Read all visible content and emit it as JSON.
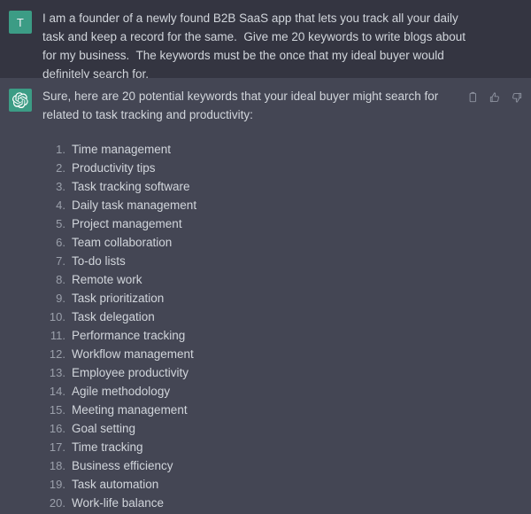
{
  "theme": {
    "user_bg": "#343541",
    "assistant_bg": "#444654",
    "text_color": "#d1d5db",
    "muted_color": "#9ba0ab",
    "avatar_bg": "#3c9c85"
  },
  "user_message": {
    "avatar_initial": "T",
    "text": "I am a founder of a newly found B2B SaaS app that lets you track all your daily task and keep a record for the same.  Give me 20 keywords to write blogs about for my business.  The keywords must be the once that my ideal buyer would definitely search for."
  },
  "assistant_message": {
    "avatar_icon": "openai-logo-icon",
    "intro": "Sure, here are 20 potential keywords that your ideal buyer might search for related to task tracking and productivity:",
    "actions": [
      {
        "name": "copy-button",
        "icon": "clipboard-icon",
        "label": "Copy"
      },
      {
        "name": "thumbs-up-button",
        "icon": "thumbs-up-icon",
        "label": "Good response"
      },
      {
        "name": "thumbs-down-button",
        "icon": "thumbs-down-icon",
        "label": "Bad response"
      }
    ],
    "keywords": [
      {
        "num": "1.",
        "text": "Time management"
      },
      {
        "num": "2.",
        "text": "Productivity tips"
      },
      {
        "num": "3.",
        "text": "Task tracking software"
      },
      {
        "num": "4.",
        "text": "Daily task management"
      },
      {
        "num": "5.",
        "text": "Project management"
      },
      {
        "num": "6.",
        "text": "Team collaboration"
      },
      {
        "num": "7.",
        "text": "To-do lists"
      },
      {
        "num": "8.",
        "text": "Remote work"
      },
      {
        "num": "9.",
        "text": "Task prioritization"
      },
      {
        "num": "10.",
        "text": "Task delegation"
      },
      {
        "num": "11.",
        "text": "Performance tracking"
      },
      {
        "num": "12.",
        "text": "Workflow management"
      },
      {
        "num": "13.",
        "text": "Employee productivity"
      },
      {
        "num": "14.",
        "text": "Agile methodology"
      },
      {
        "num": "15.",
        "text": "Meeting management"
      },
      {
        "num": "16.",
        "text": "Goal setting"
      },
      {
        "num": "17.",
        "text": "Time tracking"
      },
      {
        "num": "18.",
        "text": "Business efficiency"
      },
      {
        "num": "19.",
        "text": "Task automation"
      },
      {
        "num": "20.",
        "text": "Work-life balance"
      }
    ]
  }
}
